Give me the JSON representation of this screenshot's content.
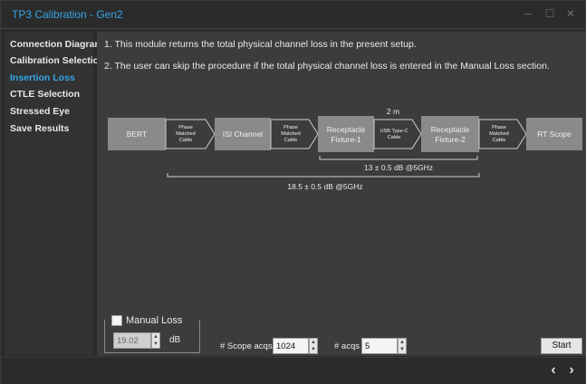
{
  "window": {
    "title": "TP3 Calibration - Gen2",
    "controls": {
      "minimize": "–",
      "maximize": "☐",
      "close": "✕"
    }
  },
  "sidebar": {
    "items": [
      {
        "label": "Connection Diagram",
        "active": false
      },
      {
        "label": "Calibration Selection",
        "active": false
      },
      {
        "label": "Insertion Loss",
        "active": true
      },
      {
        "label": "CTLE Selection",
        "active": false
      },
      {
        "label": "Stressed Eye",
        "active": false
      },
      {
        "label": "Save Results",
        "active": false
      }
    ]
  },
  "main": {
    "info_lines": [
      "1. This module returns the total physical channel loss in the present setup.",
      "2. The user can skip the procedure if the total physical channel loss is entered in the Manual Loss section."
    ],
    "diagram": {
      "blocks": {
        "bert": "BERT",
        "isi": "ISI Channel",
        "rf1_line1": "Receptacle",
        "rf1_line2": "Fixture-1",
        "rf2_line1": "Receptacle",
        "rf2_line2": "Fixture-2",
        "rt_scope": "RT Scope"
      },
      "cables": {
        "c1": [
          "Phase",
          "Matched",
          "Cable"
        ],
        "c2": [
          "Phase",
          "Matched",
          "Cable"
        ],
        "usb": [
          "USB Type-C",
          "Cable"
        ],
        "c4": [
          "Phase",
          "Matched",
          "Cable"
        ]
      },
      "usb_length": "2 m",
      "measure_inner": "13 ± 0.5 dB @5GHz",
      "measure_outer": "18.5 ± 0.5 dB @5GHz"
    },
    "manual_loss": {
      "label": "Manual Loss",
      "checked": false,
      "value": "19.02",
      "unit": "dB"
    },
    "scope_acqs": {
      "label": "# Scope acqs",
      "value": "1024"
    },
    "acqs": {
      "label": "# acqs",
      "value": "5"
    },
    "start_label": "Start"
  },
  "nav": {
    "prev": "‹",
    "next": "›"
  },
  "colors": {
    "accent": "#33a6e8",
    "block_fill": "#8a8a8a",
    "background": "#3c3c3c",
    "sidebar": "#323232"
  }
}
